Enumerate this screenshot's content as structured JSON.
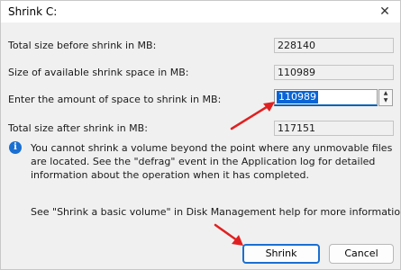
{
  "window": {
    "title": "Shrink C:",
    "close_glyph": "✕"
  },
  "fields": [
    {
      "label": "Total size before shrink in MB:",
      "value": "228140"
    },
    {
      "label": "Size of available shrink space in MB:",
      "value": "110989"
    },
    {
      "label": "Enter the amount of space to shrink in MB:",
      "value": "110989"
    },
    {
      "label": "Total size after shrink in MB:",
      "value": "117151"
    }
  ],
  "info": {
    "icon_glyph": "i",
    "text": "You cannot shrink a volume beyond the point where any unmovable files are located. See the \"defrag\" event in the Application log for detailed information about the operation when it has completed."
  },
  "help": {
    "text": "See \"Shrink a basic volume\" in Disk Management help for more information"
  },
  "buttons": {
    "shrink": "Shrink",
    "cancel": "Cancel"
  },
  "spinner": {
    "up_glyph": "▲",
    "down_glyph": "▼"
  },
  "colors": {
    "accent": "#1a6fd1",
    "annotation_arrow": "#e02020",
    "selection": "#0a64d6"
  }
}
